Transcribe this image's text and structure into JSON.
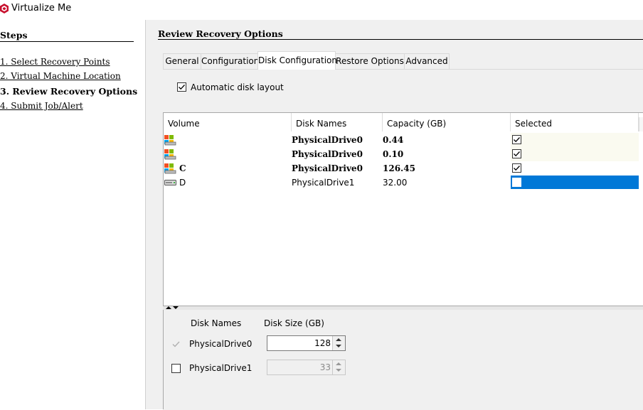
{
  "app": {
    "title": "Virtualize Me",
    "icon": "app-logo-icon",
    "accent": "#c8102e"
  },
  "steps": {
    "heading": "Steps",
    "items": [
      {
        "label": "1. Select Recovery Points",
        "active": false
      },
      {
        "label": "2. Virtual Machine Location",
        "active": false
      },
      {
        "label": "3. Review Recovery Options",
        "active": true
      },
      {
        "label": "4. Submit Job/Alert",
        "active": false
      }
    ]
  },
  "main": {
    "section_title": "Review Recovery Options",
    "tabs": [
      {
        "label": "General"
      },
      {
        "label": "Configuration"
      },
      {
        "label": "Disk Configuration",
        "active": true
      },
      {
        "label": "Restore Options"
      },
      {
        "label": "Advanced"
      }
    ],
    "auto_layout": {
      "label": "Automatic disk layout",
      "checked": true
    }
  },
  "grid": {
    "columns": [
      "Volume",
      "Disk Names",
      "Capacity (GB)",
      "Selected"
    ],
    "rows": [
      {
        "volume": "",
        "volume_icon": "system-volume-icon",
        "disk": "PhysicalDrive0",
        "capacity": "0.44",
        "selected": true,
        "bold": true
      },
      {
        "volume": "",
        "volume_icon": "system-volume-icon",
        "disk": "PhysicalDrive0",
        "capacity": "0.10",
        "selected": true,
        "bold": true
      },
      {
        "volume": "C",
        "volume_icon": "system-volume-icon",
        "disk": "PhysicalDrive0",
        "capacity": "126.45",
        "selected": true,
        "bold": true
      },
      {
        "volume": "D",
        "volume_icon": "drive-icon",
        "disk": "PhysicalDrive1",
        "capacity": "32.00",
        "selected": false,
        "bold": false,
        "highlighted": true
      }
    ],
    "highlight_color": "#0078d7"
  },
  "disks": {
    "col_names": "Disk Names",
    "col_size": "Disk Size (GB)",
    "items": [
      {
        "name": "PhysicalDrive0",
        "checked": true,
        "enabled": false,
        "size": "128",
        "size_enabled": true
      },
      {
        "name": "PhysicalDrive1",
        "checked": false,
        "enabled": true,
        "size": "33",
        "size_enabled": false
      }
    ]
  }
}
